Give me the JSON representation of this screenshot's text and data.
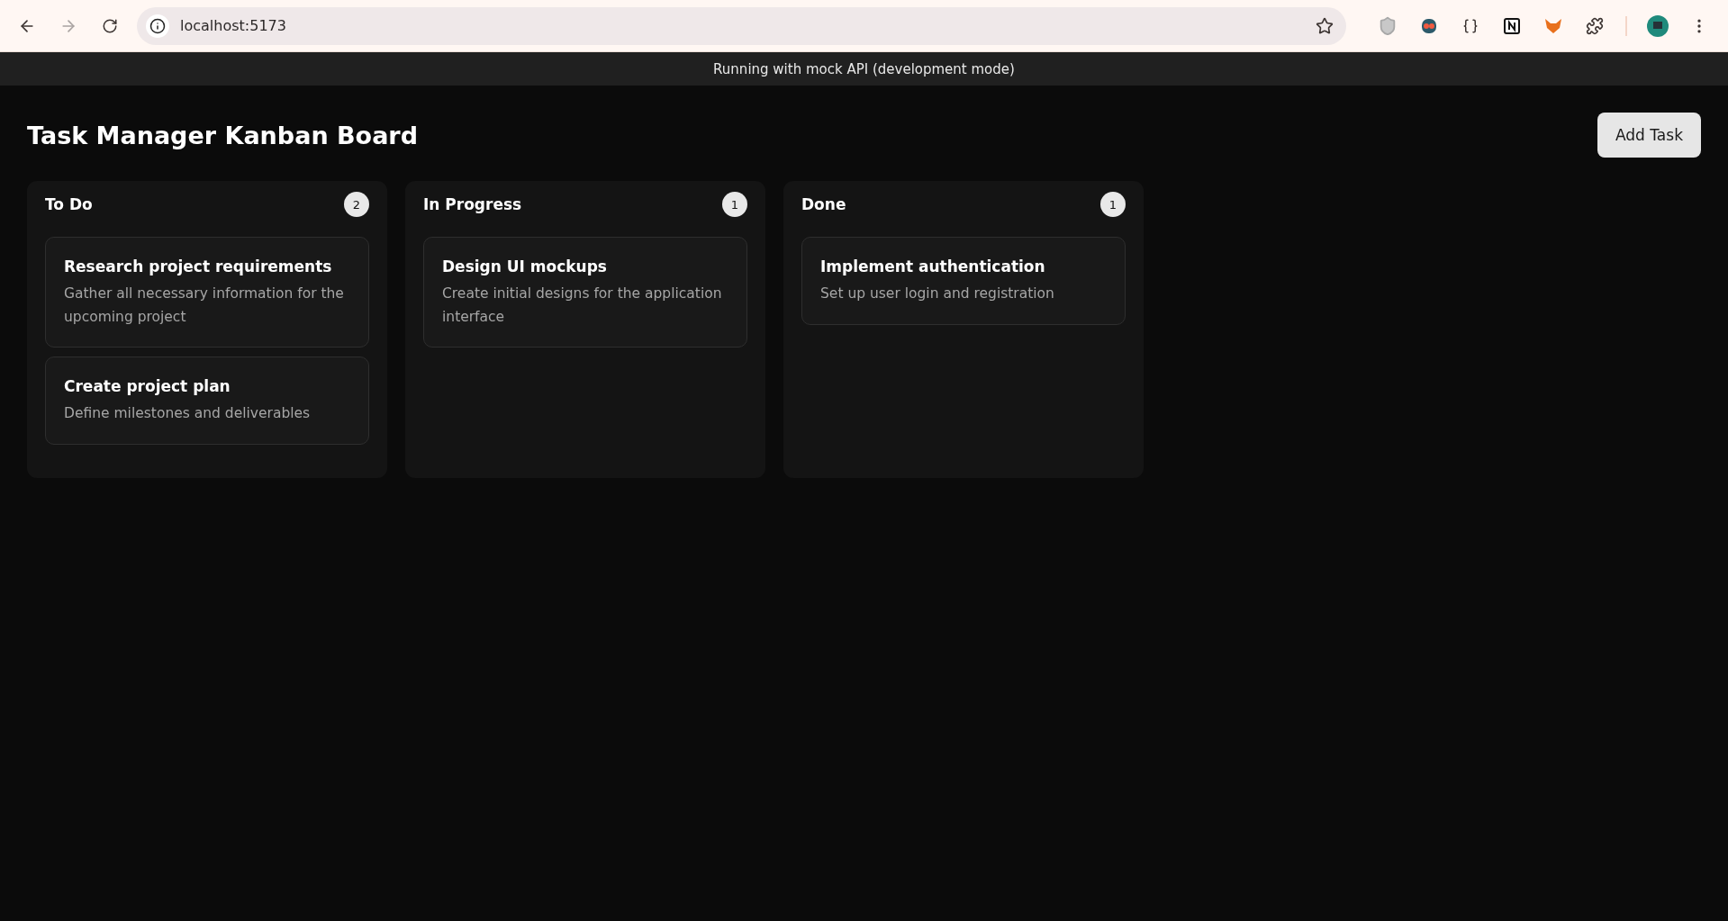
{
  "browser": {
    "url": "localhost:5173"
  },
  "banner": "Running with mock API (development mode)",
  "header": {
    "title": "Task Manager Kanban Board",
    "add_button": "Add Task"
  },
  "columns": [
    {
      "title": "To Do",
      "count": "2",
      "tasks": [
        {
          "title": "Research project requirements",
          "description": "Gather all necessary information for the upcoming project"
        },
        {
          "title": "Create project plan",
          "description": "Define milestones and deliverables"
        }
      ]
    },
    {
      "title": "In Progress",
      "count": "1",
      "tasks": [
        {
          "title": "Design UI mockups",
          "description": "Create initial designs for the application interface"
        }
      ]
    },
    {
      "title": "Done",
      "count": "1",
      "tasks": [
        {
          "title": "Implement authentication",
          "description": "Set up user login and registration"
        }
      ]
    }
  ]
}
